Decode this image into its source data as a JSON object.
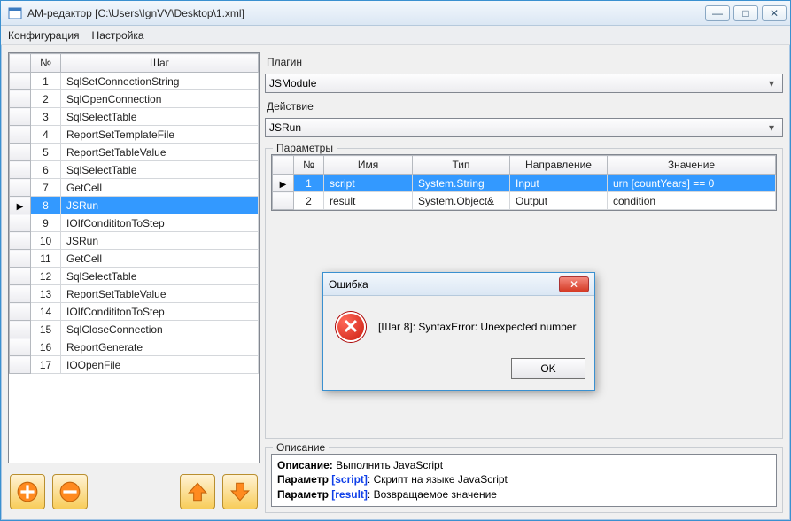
{
  "window": {
    "title": "АМ-редактор [C:\\Users\\IgnVV\\Desktop\\1.xml]"
  },
  "menu": {
    "config": "Конфигурация",
    "settings": "Настройка"
  },
  "win_buttons": {
    "min": "—",
    "max": "□",
    "close": "✕"
  },
  "steps": {
    "header_num": "№",
    "header_step": "Шаг",
    "selected_index": 8,
    "rows": [
      {
        "n": 1,
        "name": "SqlSetConnectionString"
      },
      {
        "n": 2,
        "name": "SqlOpenConnection"
      },
      {
        "n": 3,
        "name": "SqlSelectTable"
      },
      {
        "n": 4,
        "name": "ReportSetTemplateFile"
      },
      {
        "n": 5,
        "name": "ReportSetTableValue"
      },
      {
        "n": 6,
        "name": "SqlSelectTable"
      },
      {
        "n": 7,
        "name": "GetCell"
      },
      {
        "n": 8,
        "name": "JSRun"
      },
      {
        "n": 9,
        "name": "IOIfCondititonToStep"
      },
      {
        "n": 10,
        "name": "JSRun"
      },
      {
        "n": 11,
        "name": "GetCell"
      },
      {
        "n": 12,
        "name": "SqlSelectTable"
      },
      {
        "n": 13,
        "name": "ReportSetTableValue"
      },
      {
        "n": 14,
        "name": "IOIfCondititonToStep"
      },
      {
        "n": 15,
        "name": "SqlCloseConnection"
      },
      {
        "n": 16,
        "name": "ReportGenerate"
      },
      {
        "n": 17,
        "name": "IOOpenFile"
      }
    ]
  },
  "right": {
    "plugin_label": "Плагин",
    "plugin_value": "JSModule",
    "action_label": "Действие",
    "action_value": "JSRun",
    "params_label": "Параметры",
    "params_headers": {
      "num": "№",
      "name": "Имя",
      "type": "Тип",
      "direction": "Направление",
      "value": "Значение"
    },
    "params_rows": [
      {
        "n": 1,
        "name": "script",
        "type": "System.String",
        "direction": "Input",
        "value": "urn [countYears] == 0",
        "selected": true
      },
      {
        "n": 2,
        "name": "result",
        "type": "System.Object&",
        "direction": "Output",
        "value": "condition",
        "selected": false
      }
    ],
    "desc_label": "Описание",
    "desc": {
      "l1_key": "Описание:",
      "l1_val": " Выполнить JavaScript",
      "l2_key": "Параметр ",
      "l2_pk": "[script]",
      "l2_val": ": Скрипт на языке JavaScript",
      "l3_key": "Параметр ",
      "l3_pk": "[result]",
      "l3_val": ": Возвращаемое значение"
    }
  },
  "dialog": {
    "title": "Ошибка",
    "message": "[Шаг 8]: SyntaxError: Unexpected number",
    "ok": "OK"
  },
  "icons": {
    "add": "add-icon",
    "remove": "remove-icon",
    "up": "up-icon",
    "down": "down-icon"
  }
}
